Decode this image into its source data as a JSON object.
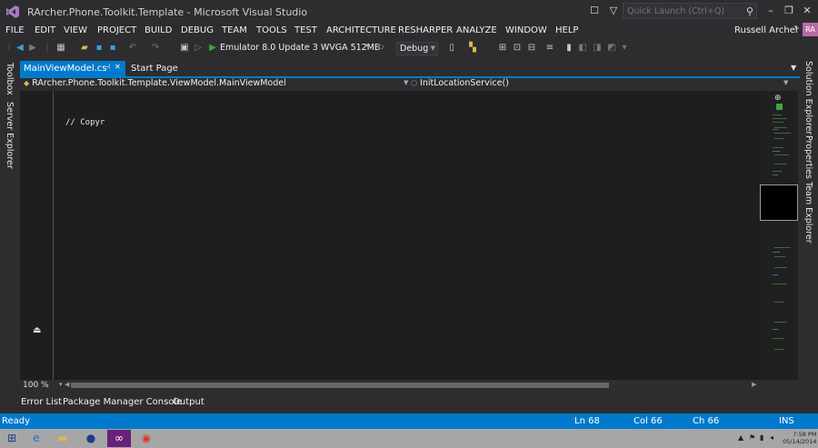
{
  "window": {
    "title": "RArcher.Phone.Toolkit.Template - Microsoft Visual Studio",
    "quick_launch_placeholder": "Quick Launch (Ctrl+Q)",
    "user_name": "Russell Archer",
    "user_initials": "RA"
  },
  "menu": [
    "FILE",
    "EDIT",
    "VIEW",
    "PROJECT",
    "BUILD",
    "DEBUG",
    "TEAM",
    "TOOLS",
    "TEST",
    "ARCHITECTURE",
    "RESHARPER",
    "ANALYZE",
    "WINDOW",
    "HELP"
  ],
  "toolbar": {
    "run_target": "Emulator 8.0 Update 3 WVGA 512MB",
    "configuration": "Debug"
  },
  "left_tool_tabs": [
    "Toolbox",
    "Server Explorer"
  ],
  "right_tool_tabs": [
    "Solution Explorer",
    "Properties",
    "Team Explorer"
  ],
  "doc_tabs": [
    {
      "label": "MainViewModel.cs",
      "active": true
    },
    {
      "label": "Start Page",
      "active": false
    }
  ],
  "nav": {
    "type": "RArcher.Phone.Toolkit.Template.ViewModel.MainViewModel",
    "member": "InitLocationService()"
  },
  "editor": {
    "code_line": "// Copyr",
    "zoom": "100 %"
  },
  "bottom_tabs": [
    "Error List",
    "Package Manager Console",
    "Output"
  ],
  "status": {
    "text": "Ready",
    "line": "Ln 68",
    "col": "Col 66",
    "ch": "Ch 66",
    "mode": "INS"
  },
  "taskbar": {
    "time": "7:58 PM",
    "date": "05/14/2014"
  },
  "colors": {
    "accent": "#007acc",
    "editor_bg": "#1e1e1e",
    "chrome_bg": "#2d2d30"
  }
}
